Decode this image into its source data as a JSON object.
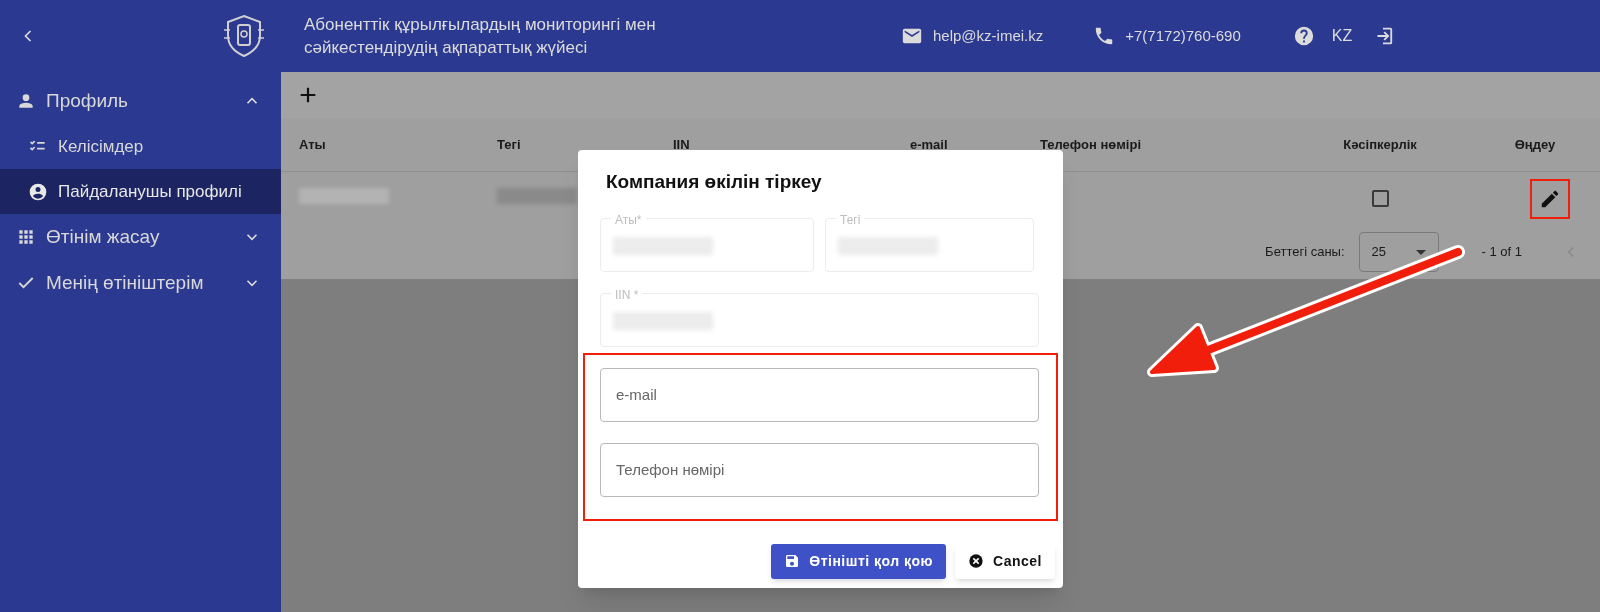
{
  "header": {
    "title": "Абоненттік құрылғылардың мониторингі мен сәйкестендірудің ақпараттық жүйесі",
    "email": "help@kz-imei.kz",
    "phone": "+7(7172)760-690",
    "language": "KZ"
  },
  "sidebar": {
    "items": [
      {
        "label": "Профиль",
        "kind": "person",
        "expanded": true,
        "children": [
          {
            "label": "Келісімдер",
            "kind": "checklist",
            "selected": false
          },
          {
            "label": "Пайдаланушы профилі",
            "kind": "account",
            "selected": true
          }
        ]
      },
      {
        "label": "Өтінім жасау",
        "kind": "grid",
        "expanded": false
      },
      {
        "label": "Менің өтініштерім",
        "kind": "check",
        "expanded": false
      }
    ]
  },
  "table": {
    "columns": [
      "Аты",
      "Тегі",
      "IIN",
      "e-mail",
      "Телефон нөмірі",
      "Кәсіпкерлік",
      "Өңдеу"
    ],
    "rows": [
      {
        "entrepreneur_checked": false
      }
    ],
    "pagination": {
      "rows_per_page_label": "Беттегі саны:",
      "rows_per_page": "25",
      "range": "- 1 of 1"
    }
  },
  "dialog": {
    "title": "Компания өкілін тіркеу",
    "fields": [
      {
        "label": "Аты*",
        "kind": "redacted"
      },
      {
        "label": "Тегі",
        "kind": "redacted"
      },
      {
        "label": "IIN *",
        "kind": "redacted"
      },
      {
        "placeholder": "e-mail",
        "kind": "empty"
      },
      {
        "placeholder": "Телефон нөмірі",
        "kind": "empty"
      }
    ],
    "buttons": [
      {
        "label": "Өтінішті қол қою",
        "kind": "primary"
      },
      {
        "label": "Cancel",
        "kind": "secondary"
      }
    ]
  }
}
